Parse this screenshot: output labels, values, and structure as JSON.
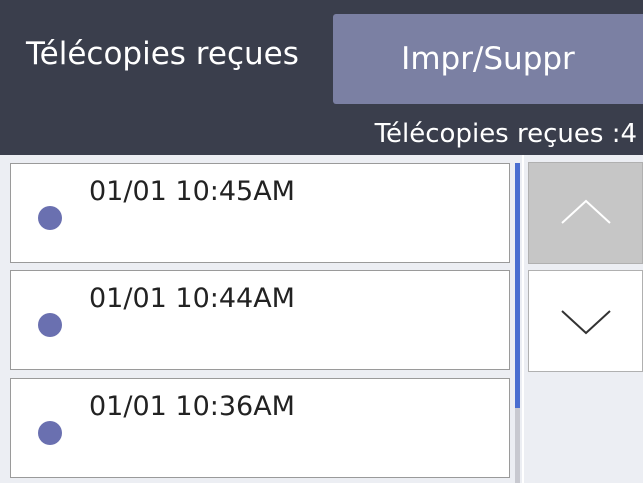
{
  "header": {
    "title": "Télécopies reçues",
    "print_delete_button": "Impr/Suppr",
    "count_text": "Télécopies reçues :4"
  },
  "fax_list": [
    {
      "timestamp": "01/01 10:45AM"
    },
    {
      "timestamp": "01/01 10:44AM"
    },
    {
      "timestamp": "01/01 10:36AM"
    }
  ],
  "icons": {
    "scroll_up": "chevron-up-icon",
    "scroll_down": "chevron-down-icon",
    "row_marker": "dot-icon"
  },
  "colors": {
    "header_bg": "#3a3e4c",
    "button_bg": "#7b80a3",
    "dot": "#6a70b0",
    "scroll_thumb": "#4a6ed0"
  }
}
